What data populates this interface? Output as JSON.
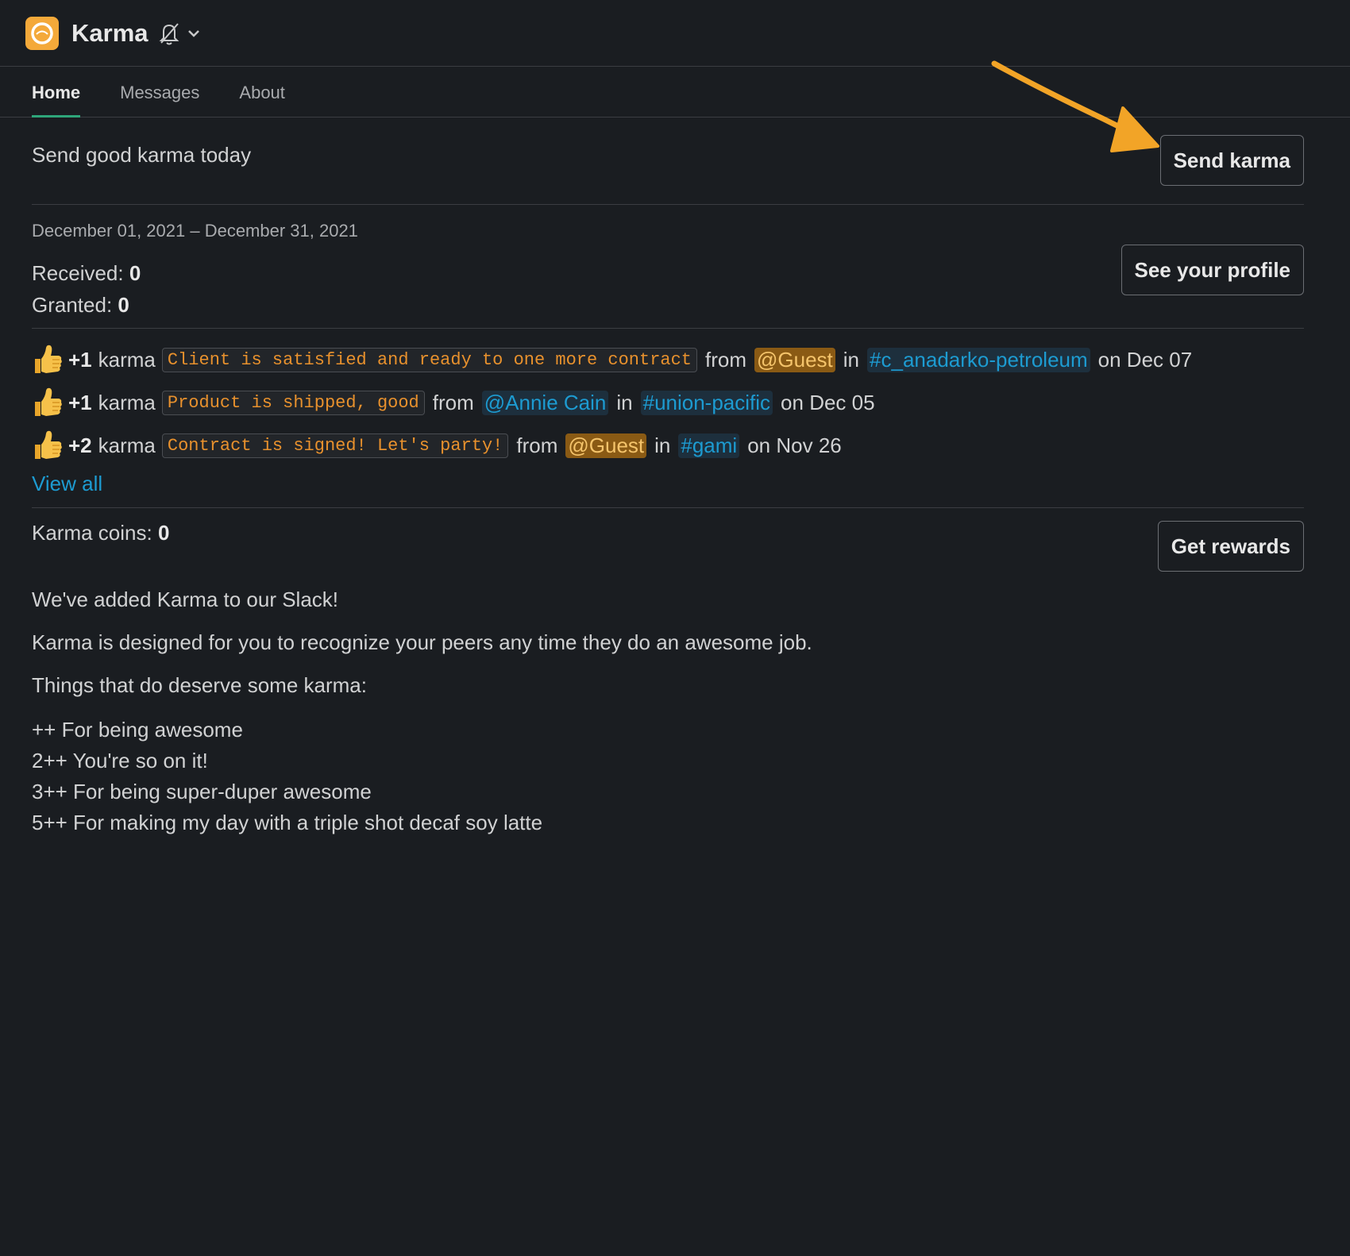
{
  "header": {
    "app_name": "Karma"
  },
  "tabs": [
    {
      "label": "Home"
    },
    {
      "label": "Messages"
    },
    {
      "label": "About"
    }
  ],
  "intro": {
    "text": "Send good karma today",
    "send_button": "Send karma"
  },
  "stats": {
    "date_range": "December 01, 2021 – December 31, 2021",
    "received_label": "Received: ",
    "received_value": "0",
    "granted_label": "Granted: ",
    "granted_value": "0",
    "profile_button": "See your profile"
  },
  "karma_items": [
    {
      "amount": "+1",
      "unit": "karma",
      "message": "Client is satisfied and ready to one more contract",
      "from_text": "from",
      "from_user": "@Guest",
      "in_text": "in",
      "channel": "#c_anadarko-petroleum",
      "date": "on Dec 07"
    },
    {
      "amount": "+1",
      "unit": "karma",
      "message": "Product is shipped, good",
      "from_text": "from",
      "from_user": "@Annie Cain",
      "in_text": "in",
      "channel": "#union-pacific",
      "date": "on Dec 05"
    },
    {
      "amount": "+2",
      "unit": "karma",
      "message": "Contract is signed! Let's party!",
      "from_text": "from",
      "from_user": "@Guest",
      "in_text": "in",
      "channel": "#gami",
      "date": "on Nov 26"
    }
  ],
  "view_all": "View all",
  "coins": {
    "label": "Karma coins: ",
    "value": "0",
    "rewards_button": "Get rewards"
  },
  "info": {
    "line1": "We've added Karma to our Slack!",
    "line2": "Karma is designed for you to recognize your peers any time they do an awesome job.",
    "line3": "Things that do deserve some karma:",
    "list": [
      "++ For being awesome",
      "2++ You're so on it!",
      "3++ For being super-duper awesome",
      "5++ For making my day with a triple shot decaf soy latte"
    ]
  },
  "colors": {
    "background": "#1a1d21",
    "accent_green": "#2ea67a",
    "link_blue": "#1d9bd1",
    "code_orange": "#e8912d",
    "logo_orange": "#f4a93a",
    "arrow_orange": "#f2a427"
  },
  "icons": {
    "logo": "karma-logo-icon",
    "notifications": "bell-off-icon",
    "dropdown": "chevron-down-icon",
    "karma_item": "thumbs-up-icon",
    "annotation": "arrow-annotation-icon"
  }
}
